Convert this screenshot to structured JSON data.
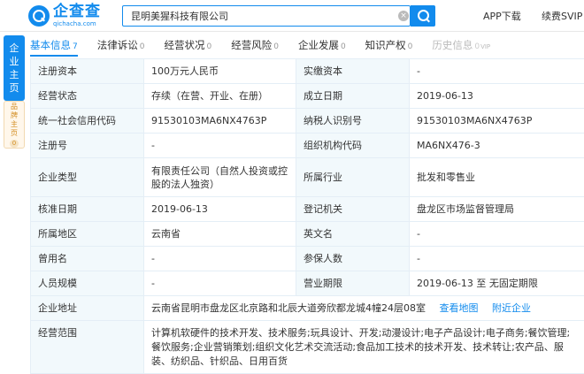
{
  "header": {
    "logo_name": "企查查",
    "logo_url": "qichacha.com",
    "search_value": "昆明美猩科技有限公司",
    "clear_icon": "×",
    "app_download": "APP下载",
    "vip": "续费SVIP",
    "accent": "#128bed"
  },
  "side": {
    "main": [
      "企",
      "业",
      "主",
      "页"
    ],
    "brand": [
      "品",
      "牌",
      "主",
      "页"
    ],
    "brand_count": "0"
  },
  "tabs": [
    {
      "label": "基本信息",
      "count": "7"
    },
    {
      "label": "法律诉讼",
      "count": "0"
    },
    {
      "label": "经营状况",
      "count": "0"
    },
    {
      "label": "经营风险",
      "count": "0"
    },
    {
      "label": "企业发展",
      "count": "0"
    },
    {
      "label": "知识产权",
      "count": "0"
    },
    {
      "label": "历史信息",
      "count": "0",
      "badge": "VIP"
    }
  ],
  "rows": [
    {
      "l1": "注册资本",
      "v1": "100万元人民币",
      "l2": "实缴资本",
      "v2": "-"
    },
    {
      "l1": "经营状态",
      "v1": "存续（在营、开业、在册）",
      "l2": "成立日期",
      "v2": "2019-06-13"
    },
    {
      "l1": "统一社会信用代码",
      "v1": "91530103MA6NX4763P",
      "l2": "纳税人识别号",
      "v2": "91530103MA6NX4763P"
    },
    {
      "l1": "注册号",
      "v1": "-",
      "l2": "组织机构代码",
      "v2": "MA6NX476-3"
    },
    {
      "l1": "企业类型",
      "v1": "有限责任公司（自然人投资或控股的法人独资）",
      "l2": "所属行业",
      "v2": "批发和零售业"
    },
    {
      "l1": "核准日期",
      "v1": "2019-06-13",
      "l2": "登记机关",
      "v2": "盘龙区市场监督管理局"
    },
    {
      "l1": "所属地区",
      "v1": "云南省",
      "l2": "英文名",
      "v2": "-"
    },
    {
      "l1": "曾用名",
      "v1": "-",
      "l2": "参保人数",
      "v2": "-"
    },
    {
      "l1": "人员规模",
      "v1": "-",
      "l2": "营业期限",
      "v2": "2019-06-13 至 无固定期限"
    }
  ],
  "address": {
    "label": "企业地址",
    "value": "云南省昆明市盘龙区北京路和北辰大道旁欣都龙城4幢24层08室",
    "map_link": "查看地图",
    "nearby_link": "附近企业"
  },
  "scope": {
    "label": "经营范围",
    "value": "计算机软硬件的技术开发、技术服务;玩具设计、开发;动漫设计;电子产品设计;电子商务;餐饮管理;餐饮服务;企业营销策划;组织文化艺术交流活动;食品加工技术的技术开发、技术转让;农产品、服装、纺织品、针织品、日用百货"
  }
}
